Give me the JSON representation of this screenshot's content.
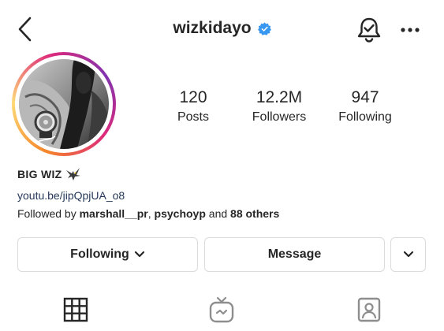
{
  "header": {
    "username": "wizkidayo",
    "verified": true,
    "icons": [
      "back-chevron-icon",
      "verified-badge-icon",
      "bell-check-icon",
      "more-horizontal-icon"
    ]
  },
  "profile": {
    "avatar_signature": "Wiz Kid",
    "stats": {
      "posts": {
        "count": "120",
        "label": "Posts"
      },
      "followers": {
        "count": "12.2M",
        "label": "Followers"
      },
      "following": {
        "count": "947",
        "label": "Following"
      }
    },
    "bio": {
      "name": "BIG WIZ",
      "name_emoji_icon": "eagle-icon",
      "link": "youtu.be/jipQpjUA_o8",
      "followed_by": {
        "prefix": "Followed by",
        "user1": "marshall__pr",
        "separator": ",",
        "user2": "psychoyp",
        "conjunction": "and",
        "others": "88 others"
      }
    }
  },
  "actions": {
    "following_label": "Following",
    "message_label": "Message"
  },
  "tabs": [
    "grid-icon",
    "igtv-icon",
    "tagged-icon"
  ],
  "colors": {
    "verified": "#3897f0",
    "link": "#27395b",
    "border": "#dbdbdb",
    "text": "#262626"
  }
}
